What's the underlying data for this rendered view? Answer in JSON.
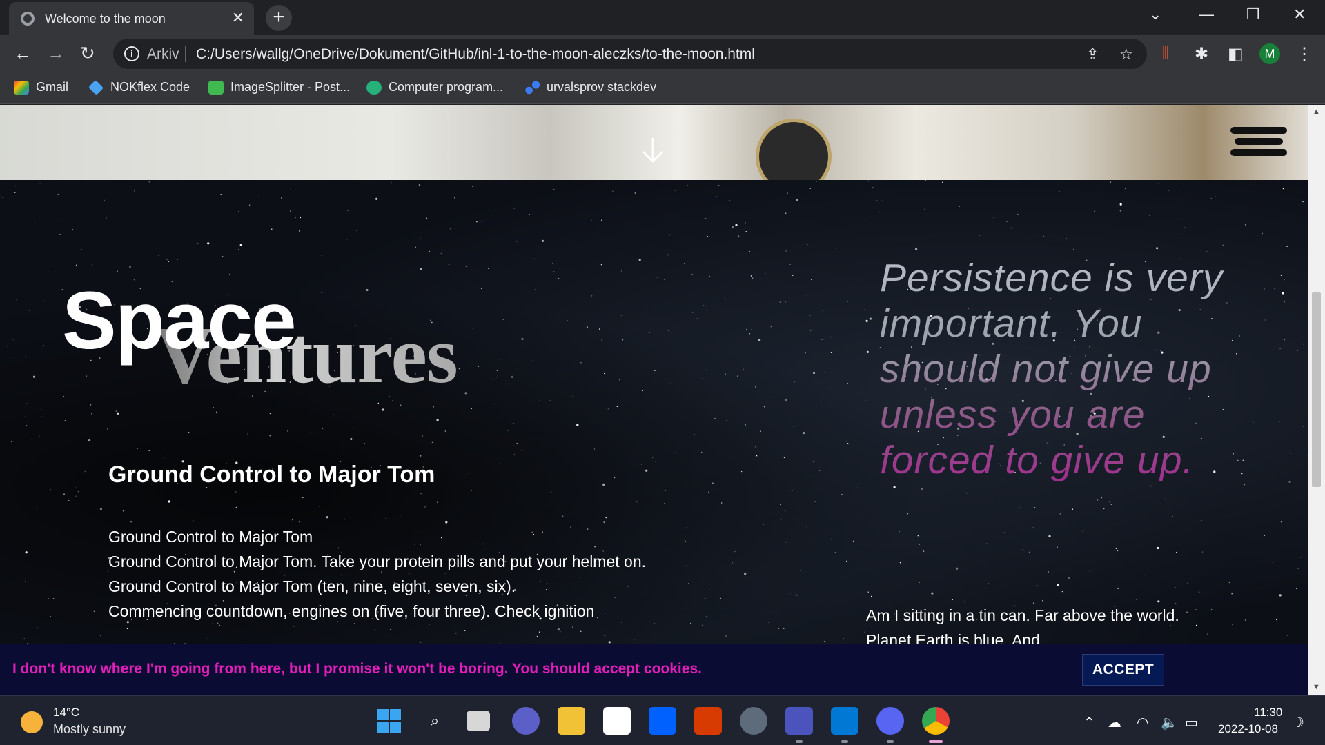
{
  "browser": {
    "tab_title": "Welcome to the moon",
    "tab_close": "✕",
    "new_tab": "+",
    "address_chip": "Arkiv",
    "url": "C:/Users/wallg/OneDrive/Dokument/GitHub/inl-1-to-the-moon-aleczks/to-the-moon.html",
    "profile_initial": "M",
    "bookmarks": [
      {
        "label": "Gmail",
        "icon": "gmail-icon",
        "color": "#ea4335"
      },
      {
        "label": "NOKflex Code",
        "icon": "diamond-icon",
        "color": "#4aa3f0"
      },
      {
        "label": "ImageSplitter - Post...",
        "icon": "grid-icon",
        "color": "#3fb950"
      },
      {
        "label": "Computer program...",
        "icon": "shield-icon",
        "color": "#26b07a"
      },
      {
        "label": "urvalsprov stackdev",
        "icon": "dots-icon",
        "color": "#3d7bf5"
      }
    ]
  },
  "page": {
    "title_word1": "Space",
    "title_word2": "Ventures",
    "section_heading": "Ground Control to Major Tom",
    "body_lines": [
      "Ground Control to Major Tom",
      "Ground Control to Major Tom. Take your protein pills and put your helmet on. Ground Control to Major Tom (ten, nine, eight, seven, six).",
      "Commencing countdown, engines on (five, four three). Check ignition"
    ],
    "quote": "Persistence is very important. You should not give up unless you are forced to give up.",
    "side_text": "Am I sitting in a tin can. Far above the world. Planet Earth is blue. And",
    "cookie_text": "I don't know where I'm going from here, but I promise it won't be boring. You should accept cookies.",
    "accept_label": "ACCEPT",
    "colors": {
      "cookie_text": "#e01fb8",
      "cookie_bar": "#0b0c33",
      "accept_bg": "#051a55"
    }
  },
  "taskbar": {
    "weather_temp": "14°C",
    "weather_desc": "Mostly sunny",
    "time": "11:30",
    "date": "2022-10-08"
  }
}
